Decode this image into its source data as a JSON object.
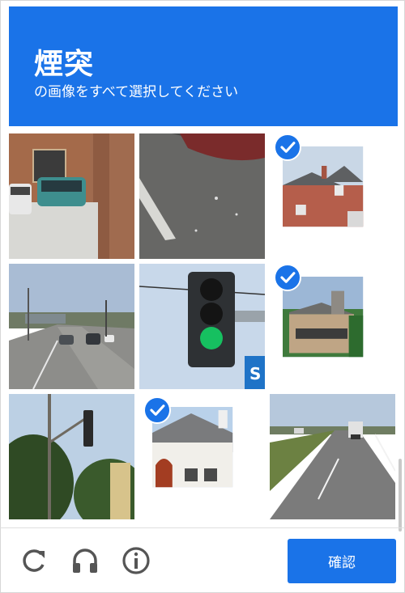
{
  "header": {
    "title": "煙突",
    "subtitle": "の画像をすべて選択してください"
  },
  "tiles": [
    {
      "scene": "parking-lot-brick-building",
      "selected": false
    },
    {
      "scene": "road-surface",
      "selected": false
    },
    {
      "scene": "brick-house",
      "selected": true
    },
    {
      "scene": "highway-street",
      "selected": false
    },
    {
      "scene": "traffic-light",
      "selected": false
    },
    {
      "scene": "house-chimney-trees",
      "selected": true
    },
    {
      "scene": "traffic-light-pole-trees",
      "selected": false
    },
    {
      "scene": "white-house-chimney",
      "selected": true
    },
    {
      "scene": "highway-truck",
      "selected": false
    }
  ],
  "footer": {
    "reload_icon": "reload-icon",
    "audio_icon": "headphones-icon",
    "info_icon": "info-icon",
    "verify_label": "確認"
  },
  "colors": {
    "accent": "#1a73e8"
  }
}
